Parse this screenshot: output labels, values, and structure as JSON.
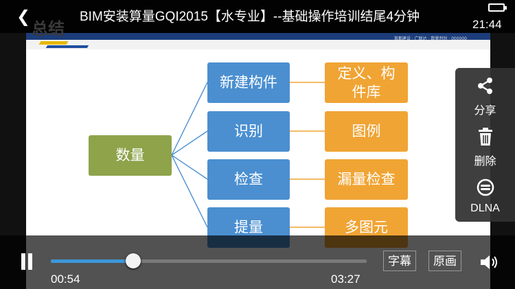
{
  "header": {
    "back_icon": "chevron-left-icon",
    "title": "BIM安装算量GQI2015【水专业】--基础操作培训结尾4分钟",
    "watermark_text": "总结",
    "clock": "21:44",
    "battery_icon": "battery-icon"
  },
  "slide": {
    "header_caption": "首都建设 · 广联达 · 数量判别 · 000000",
    "root": "数量",
    "categories": [
      "新建构件",
      "识别",
      "检查",
      "提量"
    ],
    "details": [
      "定义、构件库",
      "图例",
      "漏量检查",
      "多图元"
    ],
    "colors": {
      "root": "#8ea34a",
      "category": "#4b8fd0",
      "detail": "#f0a434",
      "connector": "#4b8fd0",
      "connector_detail": "#f0a434"
    }
  },
  "side_menu": {
    "items": [
      {
        "label": "分享",
        "icon": "share-icon"
      },
      {
        "label": "删除",
        "icon": "trash-icon"
      },
      {
        "label": "DLNA",
        "icon": "dlna-icon"
      }
    ]
  },
  "controls": {
    "current_time": "00:54",
    "total_time": "03:27",
    "progress_fraction": 0.26,
    "subtitle_label": "字幕",
    "original_label": "原画",
    "play_icon": "pause-icon",
    "volume_icon": "volume-icon",
    "accent_color": "#3d97d8"
  }
}
